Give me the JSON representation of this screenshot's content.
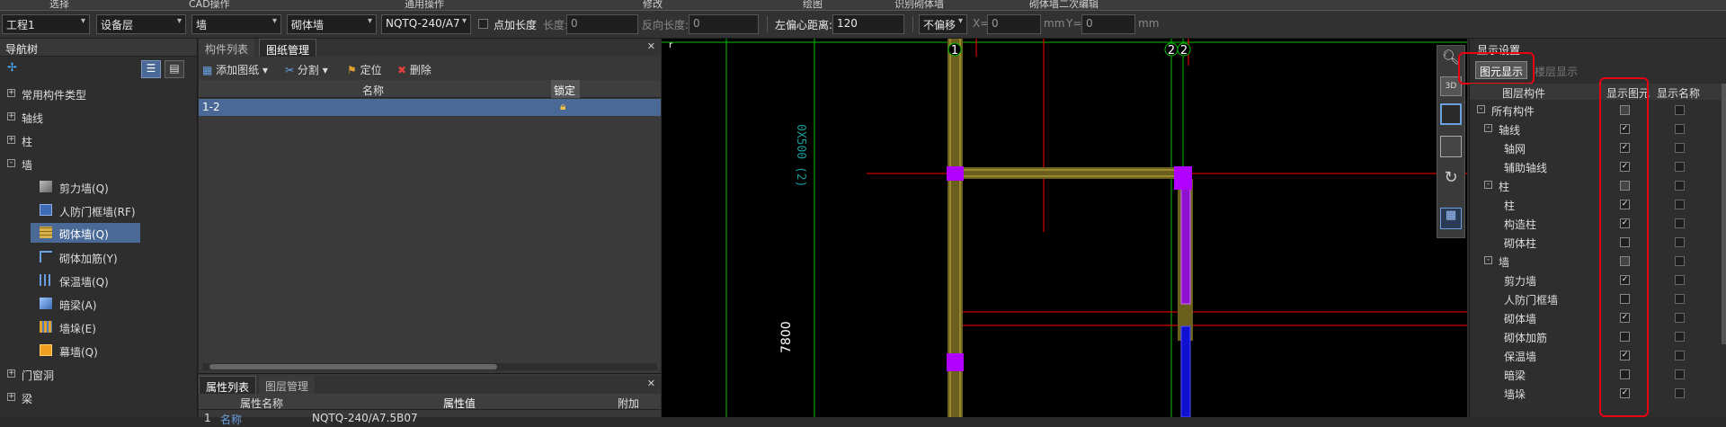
{
  "ribbon": {
    "items": [
      "选择",
      "CAD操作",
      "通用操作",
      "修改",
      "绘图",
      "识别砌体墙",
      "砌体墙二次编辑"
    ]
  },
  "toolbar": {
    "project": "工程1",
    "layer": "设备层",
    "category": "墙",
    "type": "砌体墙",
    "component": "NQTQ-240/A7",
    "point_length_label": "点加长度",
    "length_label": "长度:",
    "length_value": "0",
    "reverse_length_label": "反向长度:",
    "reverse_length_value": "0",
    "left_offset_label": "左偏心距离:",
    "left_offset_value": "120",
    "offset_mode": "不偏移",
    "x_label": "X=",
    "x_value": "0",
    "x_unit": "mm",
    "y_label": "Y=",
    "y_value": "0",
    "y_unit": "mm"
  },
  "nav": {
    "title": "导航树",
    "items": [
      {
        "label": "常用构件类型",
        "exp": "+"
      },
      {
        "label": "轴线",
        "exp": "+"
      },
      {
        "label": "柱",
        "exp": "+"
      },
      {
        "label": "墙",
        "exp": "-"
      }
    ],
    "wall_children": [
      "剪力墙(Q)",
      "人防门框墙(RF)",
      "砌体墙(Q)",
      "砌体加筋(Y)",
      "保温墙(Q)",
      "暗梁(A)",
      "墙垛(E)",
      "幕墙(Q)"
    ],
    "after_items": [
      {
        "label": "门窗洞",
        "exp": "+"
      },
      {
        "label": "梁",
        "exp": "+"
      }
    ]
  },
  "drawing_panel": {
    "tabs": [
      "构件列表",
      "图纸管理"
    ],
    "tools": [
      "添加图纸",
      "分割",
      "定位",
      "删除"
    ],
    "col_name": "名称",
    "col_lock": "锁定",
    "rows": [
      {
        "name": "1-2",
        "locked": true
      }
    ]
  },
  "props_panel": {
    "tabs": [
      "属性列表",
      "图层管理"
    ],
    "col_name": "属性名称",
    "col_value": "属性值",
    "col_extra": "附加",
    "rows": [
      {
        "idx": "1",
        "name": "名称",
        "value": "NQTQ-240/A7.5B07"
      }
    ]
  },
  "canvas": {
    "axis_labels": [
      "1",
      "2",
      "2"
    ],
    "dim_text": "7800",
    "vertical_text": "0X500 (2)"
  },
  "display": {
    "title": "显示设置",
    "tabs": [
      "图元显示",
      "楼层显示"
    ],
    "col_layer": "图层构件",
    "col_show": "显示图元",
    "col_name": "显示名称",
    "rows": [
      {
        "label": "所有构件",
        "level": 0,
        "exp": "-",
        "show": "partial",
        "name": false
      },
      {
        "label": "轴线",
        "level": 1,
        "exp": "-",
        "show": "checked",
        "name": false
      },
      {
        "label": "轴网",
        "level": 2,
        "exp": "",
        "show": "checked",
        "name": false
      },
      {
        "label": "辅助轴线",
        "level": 2,
        "exp": "",
        "show": "checked",
        "name": false
      },
      {
        "label": "柱",
        "level": 1,
        "exp": "-",
        "show": "partial",
        "name": false
      },
      {
        "label": "柱",
        "level": 2,
        "exp": "",
        "show": "checked",
        "name": false
      },
      {
        "label": "构造柱",
        "level": 2,
        "exp": "",
        "show": "checked",
        "name": false
      },
      {
        "label": "砌体柱",
        "level": 2,
        "exp": "",
        "show": "unchecked",
        "name": false
      },
      {
        "label": "墙",
        "level": 1,
        "exp": "-",
        "show": "partial",
        "name": false
      },
      {
        "label": "剪力墙",
        "level": 2,
        "exp": "",
        "show": "checked",
        "name": false
      },
      {
        "label": "人防门框墙",
        "level": 2,
        "exp": "",
        "show": "unchecked",
        "name": false
      },
      {
        "label": "砌体墙",
        "level": 2,
        "exp": "",
        "show": "checked",
        "name": false
      },
      {
        "label": "砌体加筋",
        "level": 2,
        "exp": "",
        "show": "unchecked",
        "name": false
      },
      {
        "label": "保温墙",
        "level": 2,
        "exp": "",
        "show": "checked",
        "name": false
      },
      {
        "label": "暗梁",
        "level": 2,
        "exp": "",
        "show": "unchecked",
        "name": false
      },
      {
        "label": "墙垛",
        "level": 2,
        "exp": "",
        "show": "checked",
        "name": false
      }
    ]
  },
  "colors": {
    "accent": "#4a6996",
    "highlight": "#e60012",
    "wall": "#8a7a2a",
    "column": "#b000ff",
    "axis": "#00c000",
    "grid_red": "#ff0000"
  }
}
